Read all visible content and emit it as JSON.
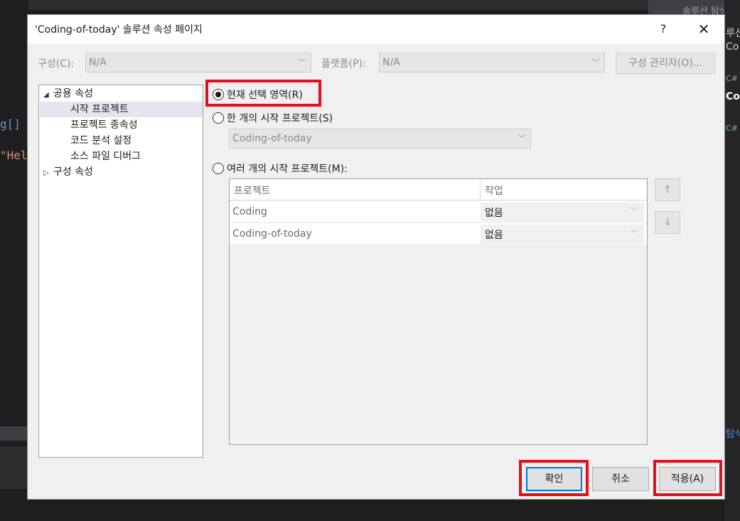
{
  "background": {
    "code_fragments": [
      {
        "text": "g[] ",
        "color": "#569cd6"
      },
      {
        "text": "\"Hel",
        "color": "#ce9178"
      }
    ],
    "right_panel": {
      "search_label": "솔루션 탐색",
      "items": [
        "루션",
        "Co",
        "",
        "C#",
        "Co",
        "",
        "C#"
      ],
      "bottom_label": "탐색"
    }
  },
  "dialog": {
    "title": "'Coding-of-today' 솔루션 속성 페이지",
    "help_label": "?",
    "close_label": "✕",
    "config_label": "구성(C):",
    "config_value": "N/A",
    "platform_label": "플랫폼(P):",
    "platform_value": "N/A",
    "config_manager_label": "구성 관리자(O)...",
    "tree": {
      "items": [
        {
          "label": "공용 속성",
          "arrow": "◢"
        },
        {
          "label": "시작 프로젝트"
        },
        {
          "label": "프로젝트 종속성"
        },
        {
          "label": "코드 분석 설정"
        },
        {
          "label": "소스 파일 디버그"
        },
        {
          "label": "구성 속성",
          "arrow": "▷"
        }
      ]
    },
    "options": {
      "current_selection": "현재 선택 영역(R)",
      "single_startup": "한 개의 시작 프로젝트(S)",
      "single_startup_value": "Coding-of-today",
      "multiple_startup": "여러 개의 시작 프로젝트(M):"
    },
    "grid": {
      "headers": [
        "프로젝트",
        "작업"
      ],
      "rows": [
        {
          "project": "Coding",
          "action": "없음"
        },
        {
          "project": "Coding-of-today",
          "action": "없음"
        }
      ]
    },
    "move_up_icon": "↑",
    "move_down_icon": "↓",
    "buttons": {
      "ok": "확인",
      "cancel": "취소",
      "apply": "적용(A)"
    }
  }
}
